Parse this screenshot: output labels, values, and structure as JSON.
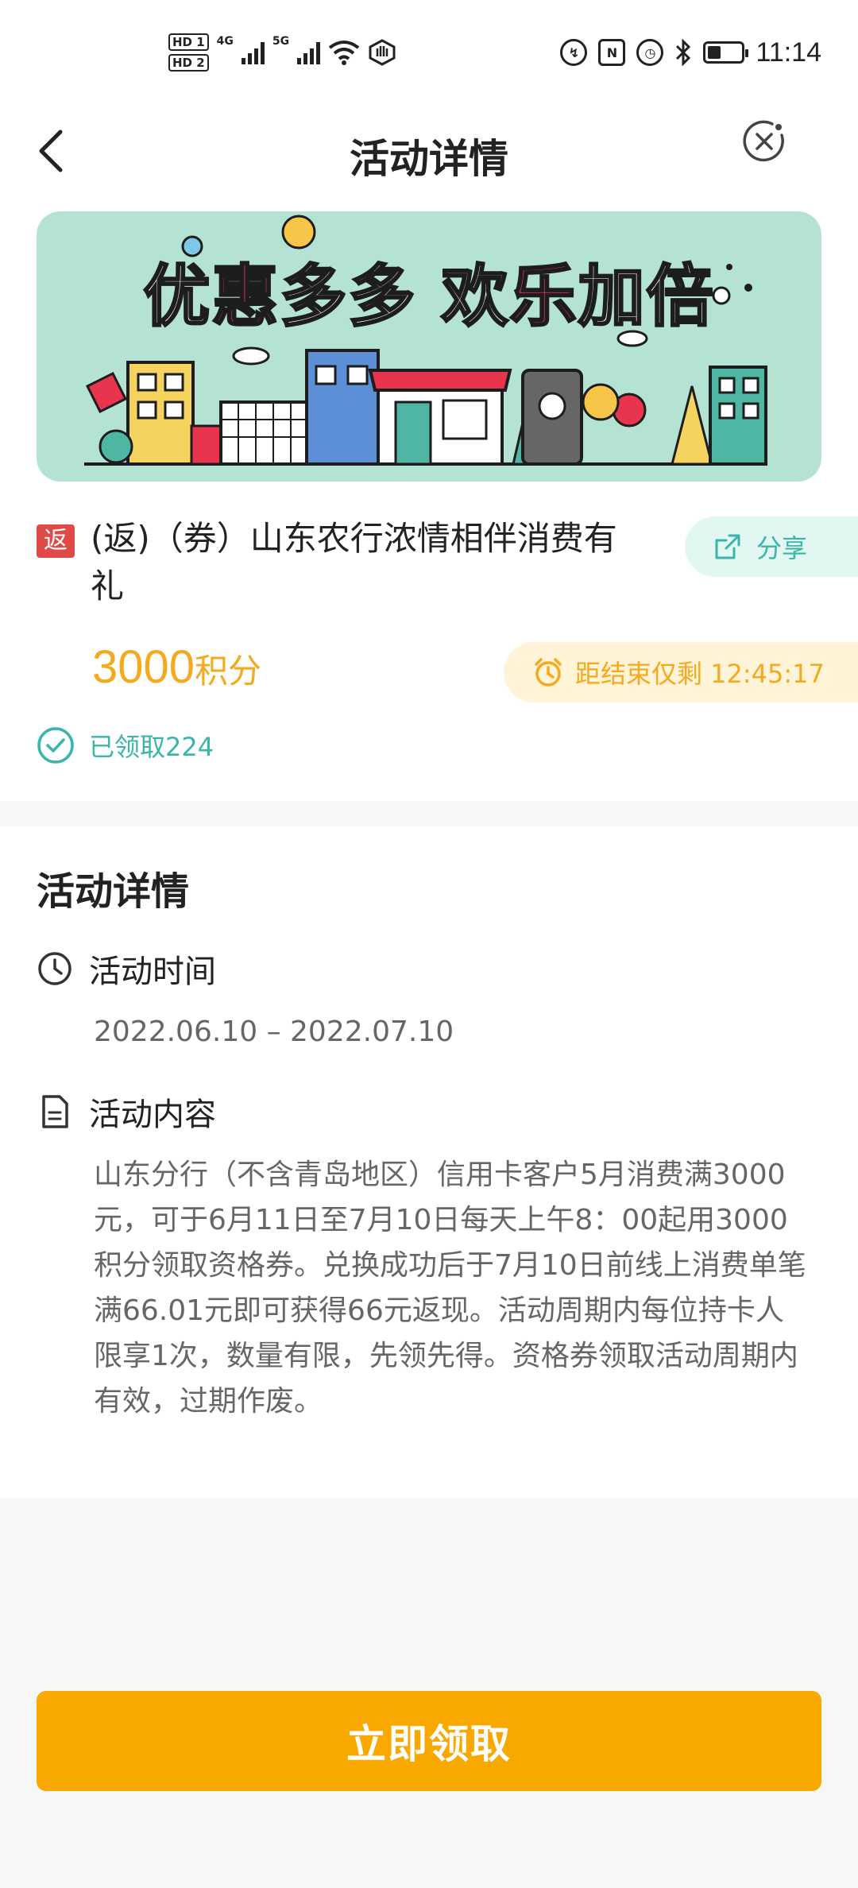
{
  "status_bar": {
    "hd1": "HD 1",
    "hd2": "HD 2",
    "net1": "4G",
    "net2": "5G",
    "time": "11:14"
  },
  "nav": {
    "title": "活动详情"
  },
  "banner": {
    "title_part1": "优",
    "title_part2": "惠",
    "title_part3": "多多 欢",
    "title_part4": "乐",
    "title_part5": "加倍"
  },
  "activity": {
    "tag": "返",
    "title": "(返)（券）山东农行浓情相伴消费有礼",
    "share_label": "分享",
    "points_value": "3000",
    "points_unit": "积分",
    "countdown": "距结束仅剩 12:45:17",
    "claimed": "已领取224"
  },
  "details": {
    "heading": "活动详情",
    "time_label": "活动时间",
    "time_value": "2022.06.10 – 2022.07.10",
    "content_label": "活动内容",
    "content_text": "山东分行（不含青岛地区）信用卡客户5月消费满3000元，可于6月11日至7月10日每天上午8：00起用3000积分领取资格券。兑换成功后于7月10日前线上消费单笔满66.01元即可获得66元返现。活动周期内每位持卡人限享1次，数量有限，先领先得。资格券领取活动周期内有效，过期作废。"
  },
  "footer": {
    "claim_button": "立即领取"
  },
  "colors": {
    "accent_teal": "#39b6a8",
    "accent_orange": "#f9a800",
    "tag_red": "#e04a46"
  }
}
